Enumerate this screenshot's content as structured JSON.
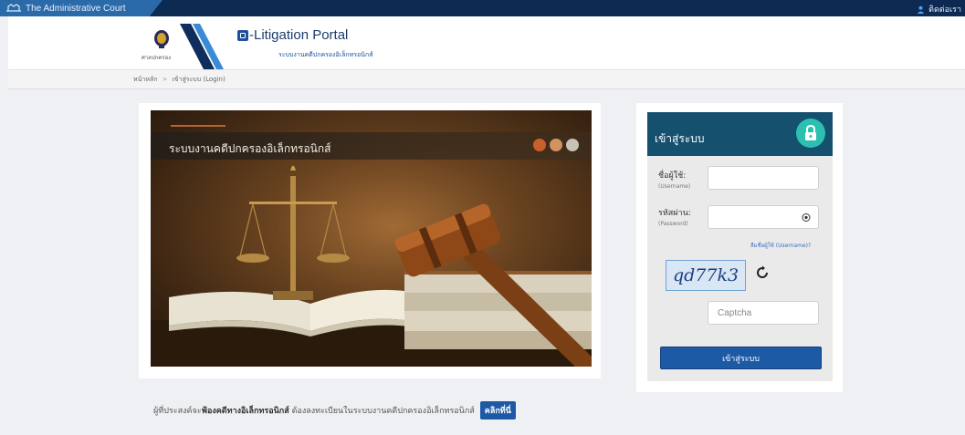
{
  "topbar": {
    "brand": "The Administrative Court",
    "contact_label": "ติดต่อเรา"
  },
  "header": {
    "seal_label": "ศาลปกครอง",
    "portal_title": "E-Litigation Portal",
    "portal_title_rest": "-Litigation Portal",
    "portal_subtitle": "ระบบงานคดีปกครองอิเล็กทรอนิกส์"
  },
  "breadcrumb": {
    "home": "หน้าหลัก",
    "separator": ">",
    "current": "เข้าสู่ระบบ (Login)"
  },
  "hero": {
    "title": "ระบบงานคดีปกครองอิเล็กทรอนิกส์",
    "dot_colors": [
      "#c9602a",
      "#d1935f",
      "#c8c2b8"
    ]
  },
  "login": {
    "title": "เข้าสู่ระบบ",
    "username_label": "ชื่อผู้ใช้:",
    "username_hint": "(Username)",
    "username_value": "",
    "password_label": "รหัสผ่าน:",
    "password_hint": "(Password)",
    "password_value": "",
    "forgot_link": "ลืมชื่อผู้ใช้ (Username)?",
    "captcha_text": "qd77k3",
    "captcha_placeholder": "Captcha",
    "submit_label": "เข้าสู่ระบบ"
  },
  "notice": {
    "prefix": "ผู้ที่ประสงค์จะ",
    "bold": "ฟ้องคดีทางอิเล็กทรอนิกส์",
    "suffix": " ต้องลงทะเบียนในระบบงานคดีปกครองอิเล็กทรอนิกส์",
    "button": "คลิกที่นี่"
  },
  "colors": {
    "topbar": "#0d2a52",
    "accent": "#1d5aa6",
    "login_header": "#15506e",
    "lock_badge": "#2cc0b0"
  }
}
